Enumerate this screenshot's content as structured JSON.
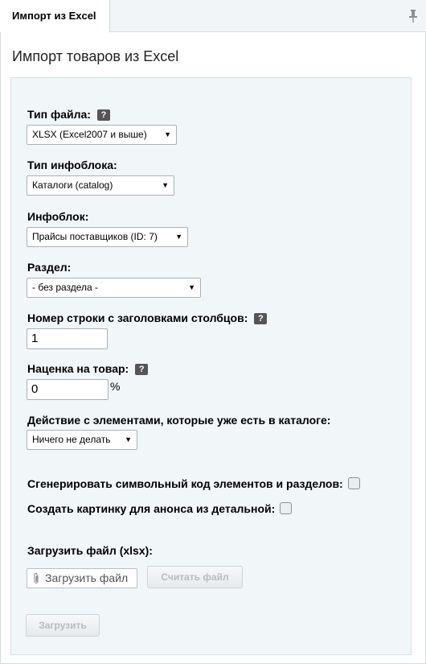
{
  "tab": {
    "label": "Импорт из Excel"
  },
  "page": {
    "title": "Импорт товаров из Excel"
  },
  "form": {
    "file_type": {
      "label": "Тип файла:",
      "value": "XLSX (Excel2007 и выше)"
    },
    "iblock_type": {
      "label": "Тип инфоблока:",
      "value": "Каталоги (catalog)"
    },
    "iblock": {
      "label": "Инфоблок:",
      "value": "Прайсы поставщиков (ID: 7)"
    },
    "section": {
      "label": "Раздел:",
      "value": "- без раздела -"
    },
    "header_row": {
      "label": "Номер строки с заголовками столбцов:",
      "value": "1"
    },
    "markup": {
      "label": "Наценка на товар:",
      "value": "0",
      "unit": "%"
    },
    "action": {
      "label": "Действие с элементами, которые уже есть в каталоге:",
      "value": "Ничего не делать"
    },
    "gen_code": {
      "label": "Сгенерировать символьный код элементов и разделов:",
      "checked": false
    },
    "create_preview": {
      "label": "Создать картинку для анонса из детальной:",
      "checked": false
    },
    "upload_file": {
      "label": "Загрузить файл (xlsx):",
      "button": "Загрузить файл",
      "read_button": "Считать файл"
    },
    "submit_button": "Загрузить",
    "help_glyph": "?"
  },
  "icons": {
    "pin": "pin-icon",
    "clip": "paperclip-icon",
    "help": "help-icon",
    "arrow": "dropdown-arrow-icon"
  }
}
